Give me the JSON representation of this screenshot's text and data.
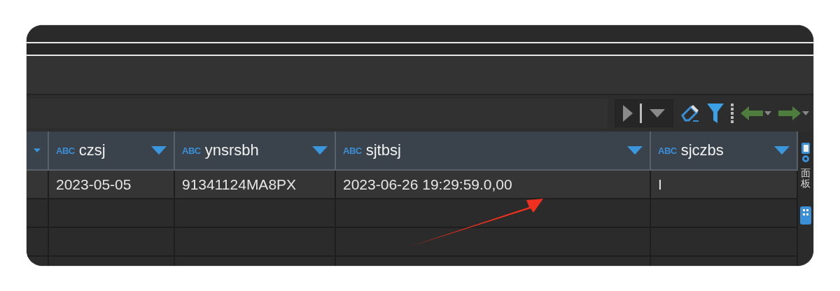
{
  "table": {
    "columns": [
      {
        "type_label": "ABC",
        "name": "czsj"
      },
      {
        "type_label": "ABC",
        "name": "ynsrsbh"
      },
      {
        "type_label": "ABC",
        "name": "sjtbsj"
      },
      {
        "type_label": "ABC",
        "name": "sjczbs"
      }
    ],
    "rows": [
      {
        "cells": [
          "2023-05-05",
          "91341124MA8PX",
          "2023-06-26 19:29:59.0,00",
          "I"
        ]
      }
    ]
  },
  "side_panel": {
    "label": "面板"
  }
}
